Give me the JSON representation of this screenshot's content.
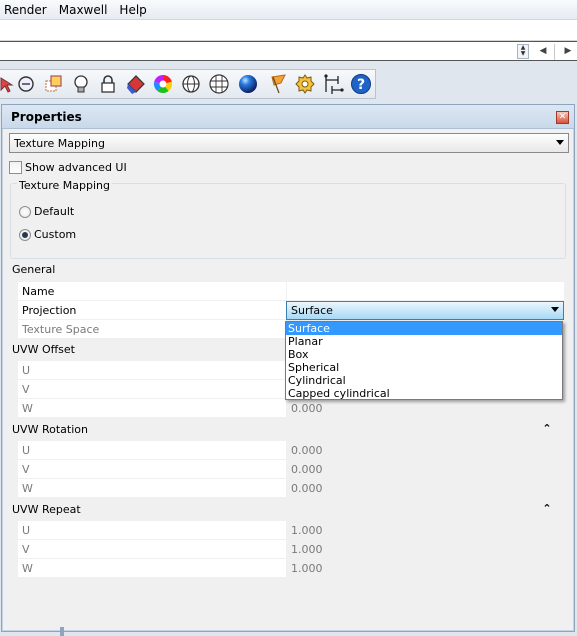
{
  "menubar": {
    "items": [
      "Render",
      "Maxwell",
      "Help"
    ]
  },
  "toolbar": {
    "icons": [
      "select-icon",
      "copy-icon",
      "lightbulb-icon",
      "lock-icon",
      "paint-bucket-icon",
      "color-wheel-icon",
      "sphere-wireframe-icon",
      "mesh-sphere-icon",
      "blue-sphere-icon",
      "flag-icon",
      "gear-icon",
      "dimension-icon",
      "help-icon"
    ]
  },
  "panel": {
    "title": "Properties",
    "selector_value": "Texture Mapping",
    "show_advanced_label": "Show advanced UI",
    "show_advanced_checked": false,
    "group_title": "Texture Mapping",
    "radio_default": "Default",
    "radio_custom": "Custom",
    "selected_radio": "Custom",
    "general_label": "General",
    "rows": {
      "name": "Name",
      "projection": "Projection",
      "projection_value": "Surface",
      "texture_space": "Texture Space"
    },
    "uvw_offset": {
      "title": "UVW Offset",
      "u": "U",
      "v": "V",
      "w": "W",
      "w_value": "0.000"
    },
    "uvw_rotation": {
      "title": "UVW Rotation",
      "u": "U",
      "v": "V",
      "w": "W",
      "u_value": "0.000",
      "v_value": "0.000",
      "w_value": "0.000"
    },
    "uvw_repeat": {
      "title": "UVW Repeat",
      "u": "U",
      "v": "V",
      "w": "W",
      "u_value": "1.000",
      "v_value": "1.000",
      "w_value": "1.000"
    },
    "dropdown": {
      "options": [
        "Surface",
        "Planar",
        "Box",
        "Spherical",
        "Cylindrical",
        "Capped cylindrical"
      ],
      "selected": "Surface"
    }
  },
  "colors": {
    "accent": "#3399ff",
    "panel_bg": "#f0f0f0",
    "panel_border": "#8fa5bf",
    "chrome_bg": "#dfe6ee"
  }
}
